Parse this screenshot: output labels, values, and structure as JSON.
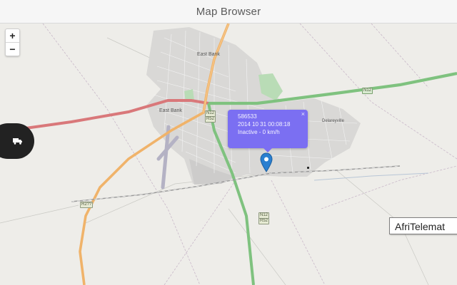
{
  "window": {
    "title": "Map Browser"
  },
  "zoom": {
    "in_label": "+",
    "out_label": "−"
  },
  "places": {
    "east_bank": "East Bank",
    "east_bank_2": "East Bank",
    "delareyville": "Delareyville"
  },
  "shields": {
    "n12_left": "N12",
    "r52_left": "R52",
    "n12_right": "N12",
    "r2xx": "R2??",
    "n12_bottom": "N12",
    "r52_bottom": "R52"
  },
  "popup": {
    "line1": "586533",
    "line2": "2014 10 31 00:08:18",
    "line3": "Inactive - 0 km/h",
    "close": "×"
  },
  "tooltip": {
    "text": "AfriTelemat"
  },
  "icons": {
    "zoom_in": "plus-icon",
    "zoom_out": "minus-icon",
    "vehicle": "truck-icon",
    "marker": "map-pin-icon"
  },
  "colors": {
    "popup_bg": "#7b6ff2",
    "red_road": "#d9787a",
    "green_road": "#7fc27f",
    "orange_road": "#f0b36a",
    "marker": "#2a7fd0"
  }
}
